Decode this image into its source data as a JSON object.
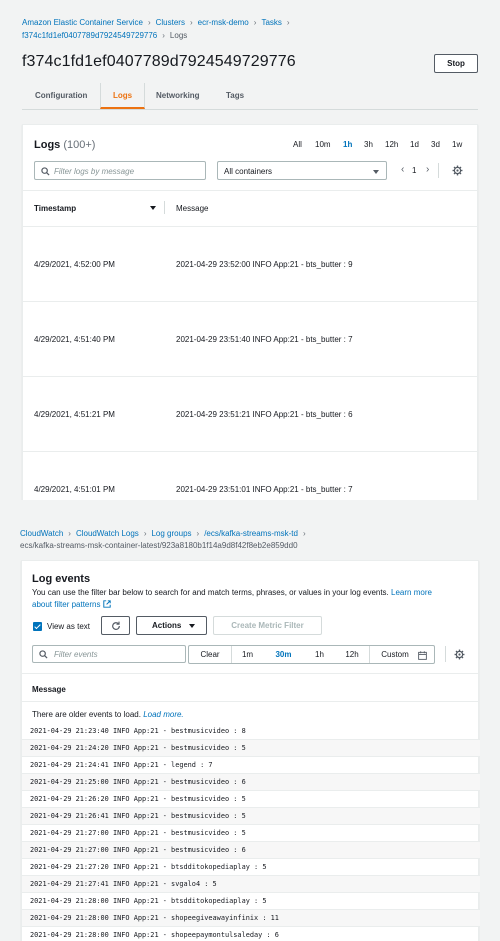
{
  "ecs": {
    "breadcrumb": [
      "Amazon Elastic Container Service",
      "Clusters",
      "ecr-msk-demo",
      "Tasks",
      "f374c1fd1ef0407789d7924549729776",
      "Logs"
    ],
    "title": "f374c1fd1ef0407789d7924549729776",
    "stop_label": "Stop",
    "tabs": [
      "Configuration",
      "Logs",
      "Networking",
      "Tags"
    ],
    "active_tab": "Logs",
    "logs": {
      "heading": "Logs",
      "count": "(100+)",
      "time_ranges": [
        "All",
        "10m",
        "1h",
        "3h",
        "12h",
        "1d",
        "3d",
        "1w"
      ],
      "selected_range": "1h",
      "filter_placeholder": "Filter logs by message",
      "container_select": "All containers",
      "page": "1",
      "columns": [
        "Timestamp",
        "Message"
      ],
      "rows": [
        {
          "timestamp": "4/29/2021, 4:52:00 PM",
          "message": "2021-04-29 23:52:00 INFO App:21 - bts_butter : 9"
        },
        {
          "timestamp": "4/29/2021, 4:51:40 PM",
          "message": "2021-04-29 23:51:40 INFO App:21 - bts_butter : 7"
        },
        {
          "timestamp": "4/29/2021, 4:51:21 PM",
          "message": "2021-04-29 23:51:21 INFO App:21 - bts_butter : 6"
        },
        {
          "timestamp": "4/29/2021, 4:51:01 PM",
          "message": "2021-04-29 23:51:01 INFO App:21 - bts_butter : 7"
        }
      ]
    }
  },
  "cw": {
    "breadcrumb": [
      "CloudWatch",
      "CloudWatch Logs",
      "Log groups",
      "/ecs/kafka-streams-msk-td"
    ],
    "stream": "ecs/kafka-streams-msk-container-latest/923a8180b1f14a9d8f42f8eb2e859dd0",
    "heading": "Log events",
    "description": "You can use the filter bar below to search for and match terms, phrases, or values in your log events.",
    "learn_more": "Learn more about filter patterns",
    "view_as_text": "View as text",
    "actions_label": "Actions",
    "create_metric_label": "Create Metric Filter",
    "filter_placeholder": "Filter events",
    "time_buttons": [
      "Clear",
      "1m",
      "30m",
      "1h",
      "12h",
      "Custom"
    ],
    "selected_time": "30m",
    "column": "Message",
    "older_events": "There are older events to load.",
    "load_more": "Load more.",
    "events": [
      "2021-04-29 21:23:40 INFO  App:21 - bestmusicvideo : 8",
      "2021-04-29 21:24:20 INFO  App:21 - bestmusicvideo : 5",
      "2021-04-29 21:24:41 INFO  App:21 - legend : 7",
      "2021-04-29 21:25:00 INFO  App:21 - bestmusicvideo : 6",
      "2021-04-29 21:26:20 INFO  App:21 - bestmusicvideo : 5",
      "2021-04-29 21:26:41 INFO  App:21 - bestmusicvideo : 5",
      "2021-04-29 21:27:00 INFO  App:21 - bestmusicvideo : 5",
      "2021-04-29 21:27:00 INFO  App:21 - bestmusicvideo : 6",
      "2021-04-29 21:27:20 INFO  App:21 - btsdditokopediaplay : 5",
      "2021-04-29 21:27:41 INFO  App:21 - svgalo4 : 5",
      "2021-04-29 21:28:00 INFO  App:21 - btsdditokopediaplay : 5",
      "2021-04-29 21:28:00 INFO  App:21 - shopeegiveawayinfinix : 11",
      "2021-04-29 21:28:00 INFO  App:21 - shopeepaymontulsaleday : 6"
    ]
  }
}
